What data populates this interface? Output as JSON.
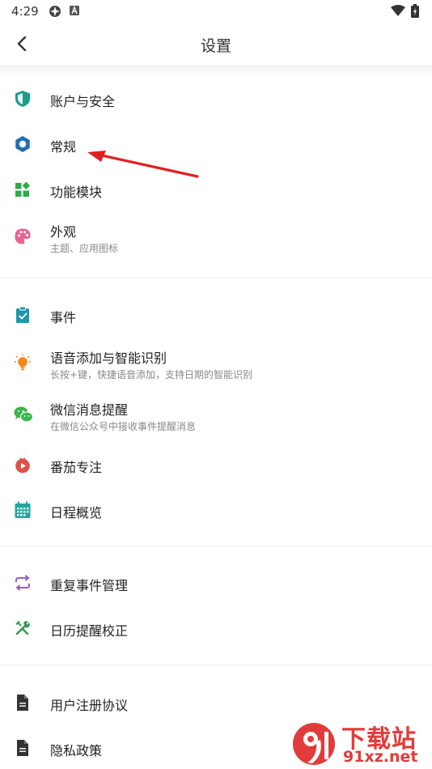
{
  "status_bar": {
    "time": "4:29"
  },
  "header": {
    "title": "设置"
  },
  "sections": {
    "account": {
      "label": "账户与安全"
    },
    "general": {
      "label": "常规"
    },
    "modules": {
      "label": "功能模块"
    },
    "appearance": {
      "label": "外观",
      "sub": "主题、应用图标"
    },
    "events": {
      "label": "事件"
    },
    "voice": {
      "label": "语音添加与智能识别",
      "sub": "长按+键，快捷语音添加，支持日期的智能识别"
    },
    "wechat": {
      "label": "微信消息提醒",
      "sub": "在微信公众号中接收事件提醒消息"
    },
    "pomodoro": {
      "label": "番茄专注"
    },
    "overview": {
      "label": "日程概览"
    },
    "recurring": {
      "label": "重复事件管理"
    },
    "calibrate": {
      "label": "日历提醒校正"
    },
    "agreement": {
      "label": "用户注册协议"
    },
    "privacy": {
      "label": "隐私政策"
    }
  },
  "watermark": {
    "text": "下载站",
    "domain": "91xz.net"
  },
  "colors": {
    "shield": "#1a9c8c",
    "gear": "#1f6fb5",
    "modules": "#2eaa4a",
    "palette": "#e8638f",
    "events": "#2196a8",
    "bulb": "#f2871e",
    "wechat": "#3bb54a",
    "tomato": "#e0504a",
    "calendar": "#1fa8a0",
    "repeat": "#9b59c9",
    "tools": "#2e9a58",
    "doc": "#333333",
    "arrow": "#e02020"
  }
}
